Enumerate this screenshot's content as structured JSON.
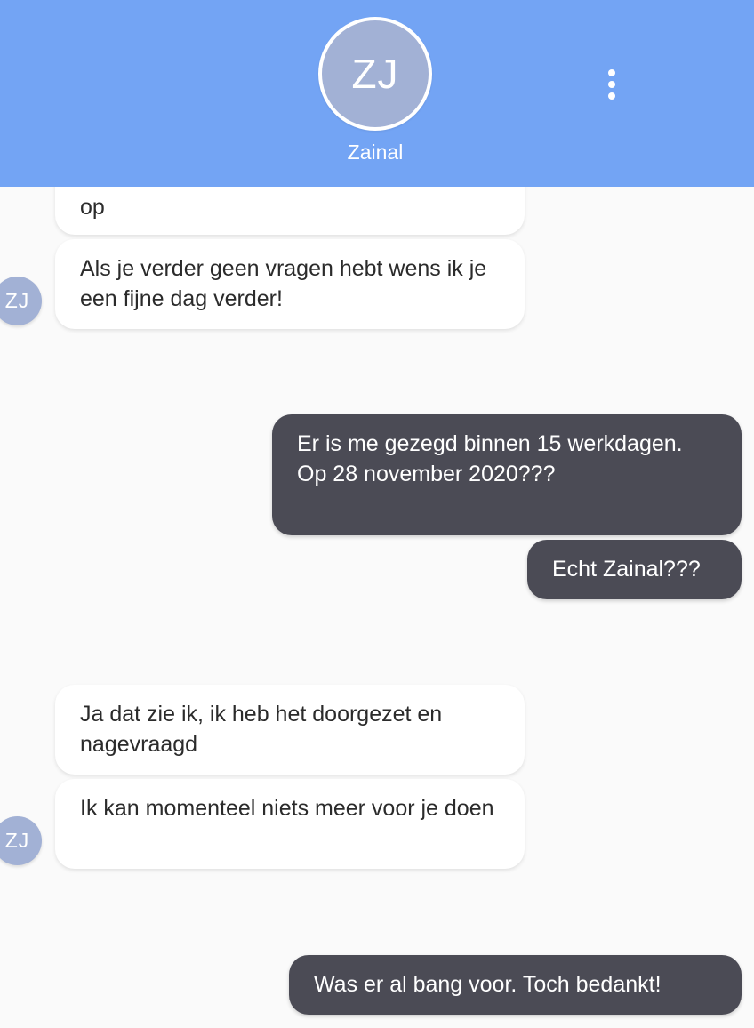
{
  "header": {
    "avatar_initials": "ZJ",
    "contact_name": "Zainal",
    "background_color": "#73a4f4",
    "menu_icon": "more-vertical-icon"
  },
  "messages": [
    {
      "sender": "agent",
      "text": "op"
    },
    {
      "sender": "agent",
      "text": "Als je verder geen vragen hebt wens ik je een fijne dag verder!",
      "avatar": "ZJ"
    },
    {
      "sender": "user",
      "text": "Er is me gezegd binnen 15 werkdagen. Op 28 november 2020???"
    },
    {
      "sender": "user",
      "text": "Echt Zainal???"
    },
    {
      "sender": "agent",
      "text": "Ja dat zie ik, ik heb het doorgezet en nagevraagd"
    },
    {
      "sender": "agent",
      "text": "Ik kan momenteel niets meer voor je doen",
      "avatar": "ZJ"
    },
    {
      "sender": "user",
      "text": "Was er al bang voor. Toch bedankt!"
    }
  ],
  "colors": {
    "incoming_bubble": "#ffffff",
    "outgoing_bubble": "#4b4b55",
    "avatar": "#a2b1d5",
    "background": "#fafafa"
  }
}
